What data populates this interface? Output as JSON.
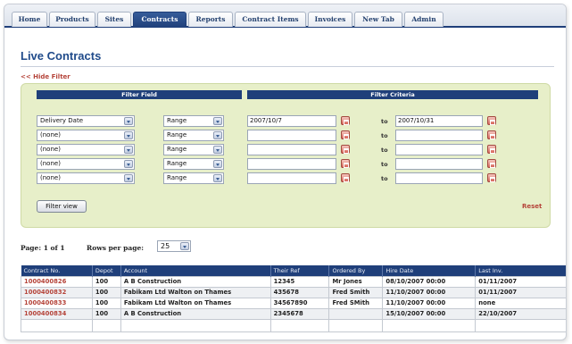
{
  "tabs": [
    {
      "label": "Home",
      "active": false
    },
    {
      "label": "Products",
      "active": false
    },
    {
      "label": "Sites",
      "active": false
    },
    {
      "label": "Contracts",
      "active": true
    },
    {
      "label": "Reports",
      "active": false
    },
    {
      "label": "Contract Items",
      "active": false
    },
    {
      "label": "Invoices",
      "active": false
    },
    {
      "label": "New Tab",
      "active": false
    },
    {
      "label": "Admin",
      "active": false
    }
  ],
  "page_title": "Live Contracts",
  "hide_filter_link": "<< Hide Filter",
  "filter": {
    "field_header": "Filter Field",
    "criteria_header": "Filter Criteria",
    "to_label": "to",
    "rows": [
      {
        "field": "Delivery Date",
        "operator": "Range",
        "from": "2007/10/7",
        "to": "2007/10/31"
      },
      {
        "field": "(none)",
        "operator": "Range",
        "from": "",
        "to": ""
      },
      {
        "field": "(none)",
        "operator": "Range",
        "from": "",
        "to": ""
      },
      {
        "field": "(none)",
        "operator": "Range",
        "from": "",
        "to": ""
      },
      {
        "field": "(none)",
        "operator": "Range",
        "from": "",
        "to": ""
      }
    ],
    "filter_button": "Filter view",
    "reset_link": "Reset"
  },
  "pager": {
    "page_text": "Page: 1 of 1",
    "rows_label": "Rows per page:",
    "rows_value": "25"
  },
  "table": {
    "columns": [
      "Contract No.",
      "Depot",
      "Account",
      "Their Ref",
      "Ordered By",
      "Hire Date",
      "Last Inv."
    ],
    "rows": [
      [
        "1000400826",
        "100",
        "A B Construction",
        "12345",
        "Mr Jones",
        "08/10/2007 00:00",
        "01/11/2007"
      ],
      [
        "1000400832",
        "100",
        "Fabikam Ltd Walton on Thames",
        "435678",
        "Fred Smith",
        "11/10/2007 00:00",
        "01/11/2007"
      ],
      [
        "1000400833",
        "100",
        "Fabikam Ltd Walton on Thames",
        "34567890",
        "Fred SMith",
        "11/10/2007 00:00",
        "none"
      ],
      [
        "1000400834",
        "100",
        "A B Construction",
        "2345678",
        "",
        "15/10/2007 00:00",
        "22/10/2007"
      ]
    ]
  },
  "colors": {
    "nav_blue": "#1f3f7a",
    "title_blue": "#1f4a8a",
    "link_red": "#b5443a",
    "filter_bg": "#e7efc9"
  }
}
